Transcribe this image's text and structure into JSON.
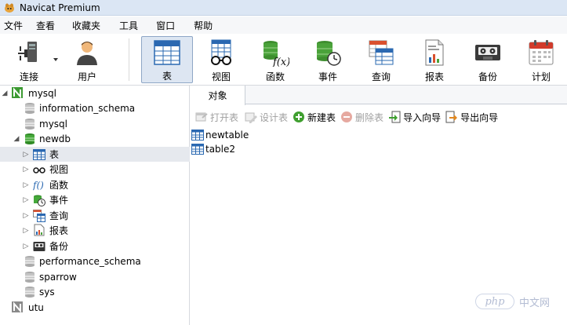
{
  "window": {
    "title": "Navicat Premium"
  },
  "menu": [
    "文件",
    "查看",
    "收藏夹",
    "工具",
    "窗口",
    "帮助"
  ],
  "toolbar": {
    "connect": "连接",
    "user": "用户",
    "table": "表",
    "view": "视图",
    "function": "函数",
    "event": "事件",
    "query": "查询",
    "report": "报表",
    "backup": "备份",
    "schedule": "计划"
  },
  "tree": {
    "mysql": "mysql",
    "information_schema": "information_schema",
    "mysql_db": "mysql",
    "newdb": "newdb",
    "tables": "表",
    "views": "视图",
    "functions": "函数",
    "events": "事件",
    "queries": "查询",
    "reports": "报表",
    "backups": "备份",
    "performance_schema": "performance_schema",
    "sparrow": "sparrow",
    "sys": "sys",
    "utu": "utu"
  },
  "objects_tab": "对象",
  "object_toolbar": {
    "open": "打开表",
    "design": "设计表",
    "new": "新建表",
    "delete": "删除表",
    "import": "导入向导",
    "export": "导出向导"
  },
  "tables": [
    "newtable",
    "table2"
  ],
  "watermark": {
    "logo": "php",
    "text": "中文网"
  }
}
